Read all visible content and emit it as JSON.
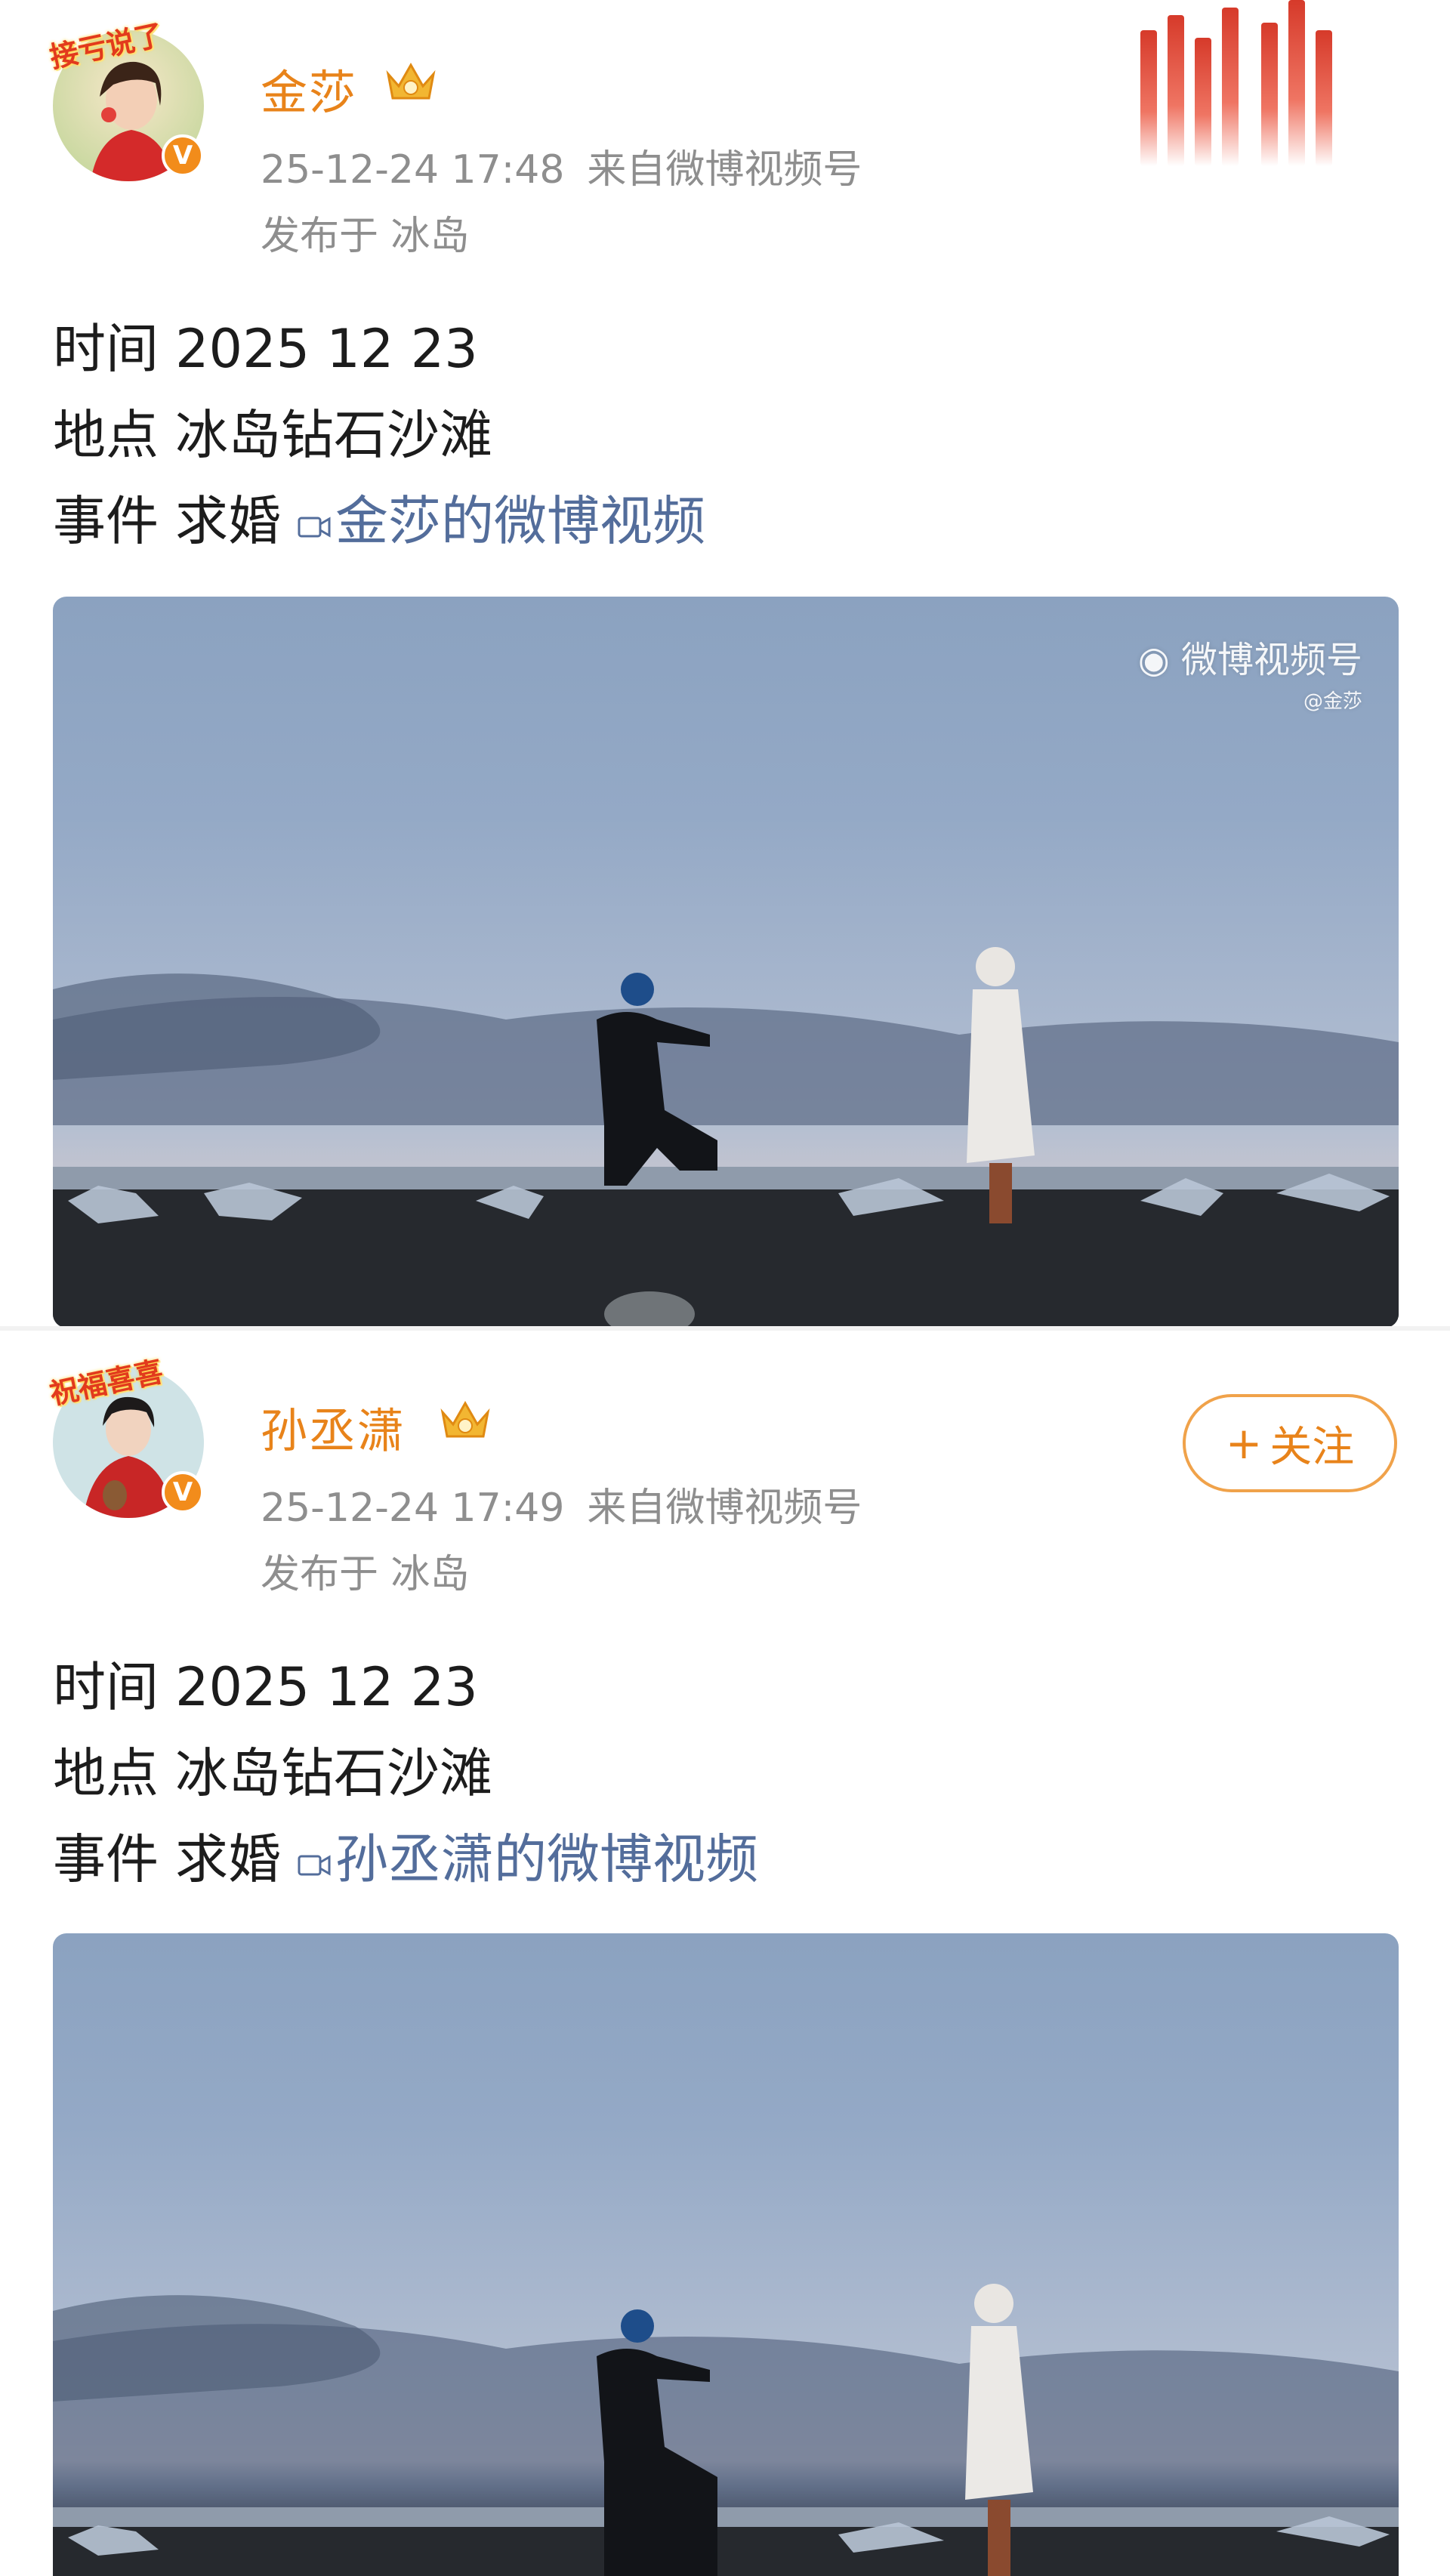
{
  "posts": [
    {
      "avatar_frame_text": "接亏说了",
      "username": "金莎",
      "timestamp": "25-12-24 17:48",
      "source": "来自微博视频号",
      "location": "发布于 冰岛",
      "lines": [
        {
          "label": "时间",
          "value": "2025 12 23"
        },
        {
          "label": "地点",
          "value": "冰岛钻石沙滩"
        },
        {
          "label": "事件",
          "value": "求婚"
        }
      ],
      "video_link": "金莎的微博视频",
      "watermark": {
        "title": "微博视频号",
        "handle": "@金莎"
      },
      "icons": {
        "crown": "crown-icon",
        "verified": "verified-badge-icon",
        "video": "video-camera-icon",
        "weibo": "weibo-logo-icon"
      }
    },
    {
      "avatar_frame_text": "祝福喜喜",
      "username": "孙丞潇",
      "timestamp": "25-12-24 17:49",
      "source": "来自微博视频号",
      "location": "发布于 冰岛",
      "follow_label": "关注",
      "lines": [
        {
          "label": "时间",
          "value": "2025 12 23"
        },
        {
          "label": "地点",
          "value": "冰岛钻石沙滩"
        },
        {
          "label": "事件",
          "value": "求婚"
        }
      ],
      "video_link": "孙丞潇的微博视频",
      "icons": {
        "crown": "crown-icon",
        "verified": "verified-badge-icon",
        "video": "video-camera-icon",
        "plus": "plus-icon"
      }
    }
  ],
  "colors": {
    "username": "#e8831a",
    "meta": "#8e8e8e",
    "link": "#536d9b",
    "verified": "#f28c1b"
  }
}
